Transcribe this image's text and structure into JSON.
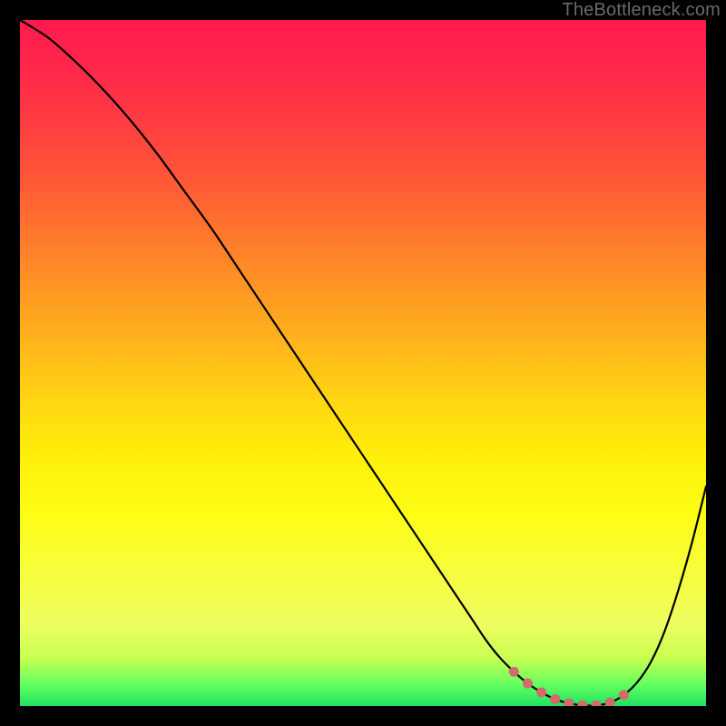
{
  "watermark": "TheBottleneck.com",
  "colors": {
    "frame": "#000000",
    "curve_stroke": "#000000",
    "marker_fill": "#d46a6a",
    "gradient_top": "#ff1a4d",
    "gradient_bottom": "#20e060"
  },
  "chart_data": {
    "type": "line",
    "title": "",
    "xlabel": "",
    "ylabel": "",
    "xlim": [
      0,
      100
    ],
    "ylim": [
      0,
      100
    ],
    "grid": false,
    "legend": false,
    "series": [
      {
        "name": "curve",
        "x": [
          0,
          4,
          8,
          12,
          16,
          20,
          24,
          28,
          32,
          36,
          40,
          44,
          48,
          52,
          56,
          60,
          62,
          64,
          66,
          68,
          70,
          72,
          74,
          76,
          78,
          80,
          82,
          84,
          86,
          88,
          90,
          92,
          94,
          96,
          98,
          100
        ],
        "y": [
          100,
          97.5,
          94,
          90,
          85.5,
          80.5,
          75,
          69.5,
          63.5,
          57.5,
          51.5,
          45.5,
          39.5,
          33.5,
          27.5,
          21.5,
          18.5,
          15.5,
          12.5,
          9.5,
          7,
          5,
          3.3,
          2,
          1,
          0.4,
          0.1,
          0.1,
          0.5,
          1.6,
          3.5,
          6.5,
          11,
          17,
          24,
          32
        ]
      }
    ],
    "markers": {
      "name": "highlight-points",
      "x": [
        72,
        74,
        76,
        78,
        80,
        82,
        84,
        86,
        88
      ],
      "y": [
        5,
        3.3,
        2,
        1,
        0.4,
        0.1,
        0.1,
        0.5,
        1.6
      ]
    },
    "annotations": []
  }
}
